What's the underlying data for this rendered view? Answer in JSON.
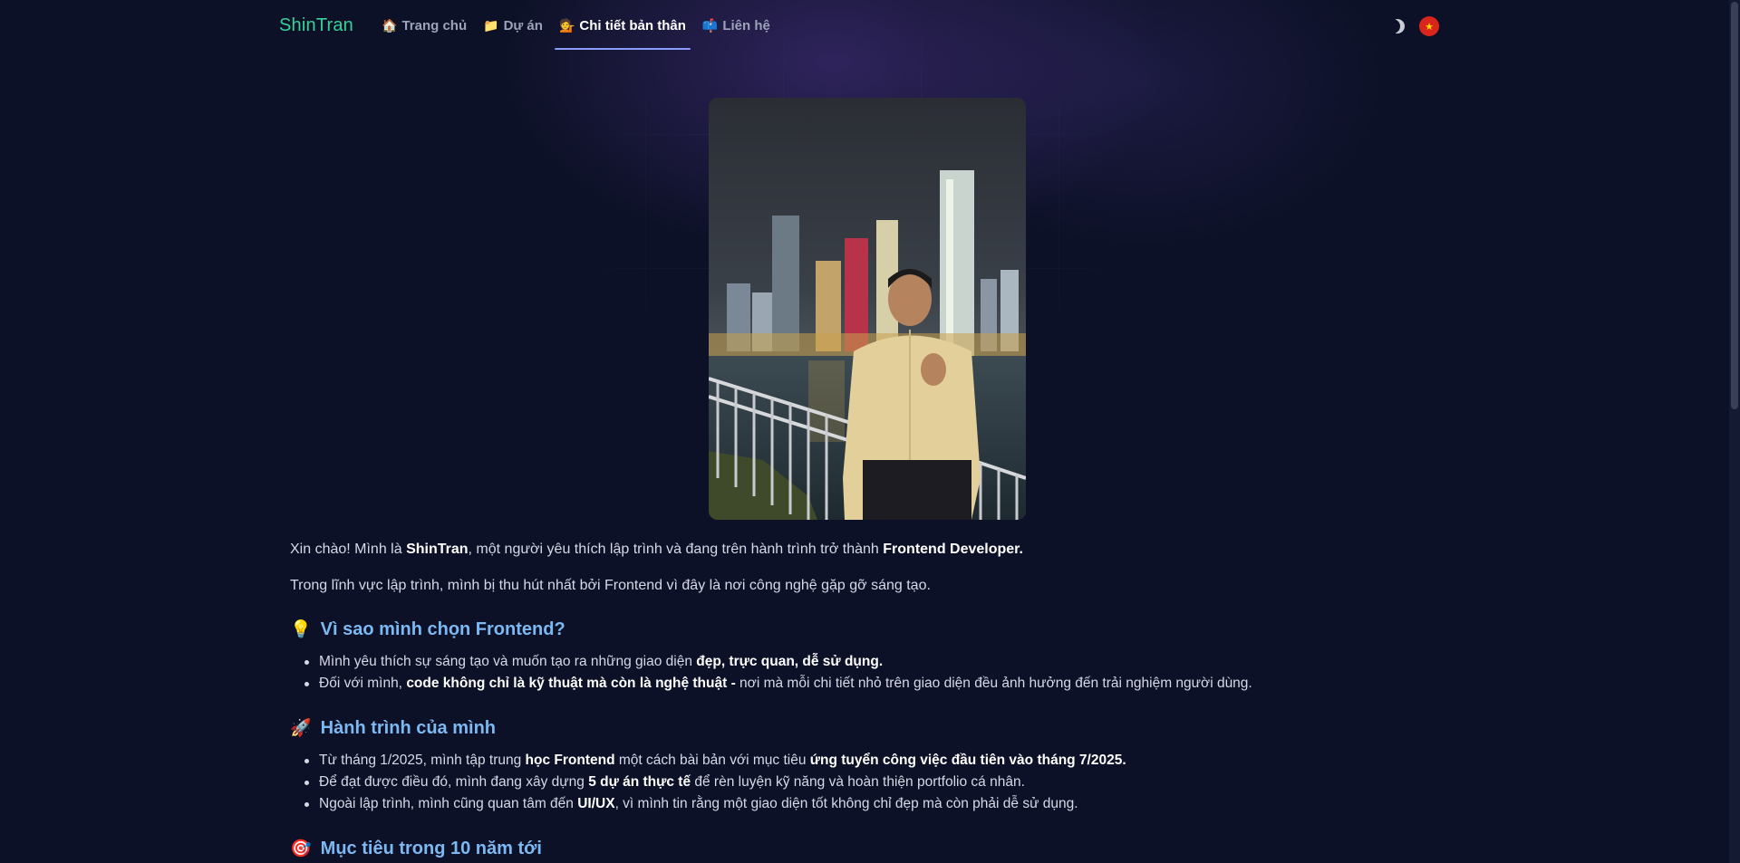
{
  "nav": {
    "logo": "ShinTran",
    "links": [
      {
        "emoji": "🏠",
        "label": "Trang chủ"
      },
      {
        "emoji": "📁",
        "label": "Dự án"
      },
      {
        "emoji": "💁",
        "label": "Chi tiết bản thân"
      },
      {
        "emoji": "📫",
        "label": "Liên hệ"
      }
    ],
    "active_index": 2,
    "theme_toggle_icon": "moon-icon",
    "language_flag_icon": "vietnam-flag-icon",
    "flag_star": "★"
  },
  "colors": {
    "background": "#0d1127",
    "logo": "#34d399",
    "heading": "#7cb9f3",
    "active_underline": "#8b9cff"
  },
  "intro": {
    "p1": {
      "t1": "Xin chào! Mình là ",
      "b1": "ShinTran",
      "t2": ", một người yêu thích lập trình và đang trên hành trình trở thành ",
      "b2": "Frontend Developer."
    },
    "p2": "Trong lĩnh vực lập trình, mình bị thu hút nhất bởi Frontend vì đây là nơi công nghệ gặp gỡ sáng tạo."
  },
  "sections": [
    {
      "emoji": "💡",
      "title": "Vì sao mình chọn Frontend?",
      "bullets": [
        {
          "t1": "Mình yêu thích sự sáng tạo và muốn tạo ra những giao diện ",
          "b1": "đẹp, trực quan, dễ sử dụng."
        },
        {
          "t1": "Đối với mình, ",
          "b1": "code không chỉ là kỹ thuật mà còn là nghệ thuật -",
          "t2": " nơi mà mỗi chi tiết nhỏ trên giao diện đều ảnh hưởng đến trải nghiệm người dùng."
        }
      ]
    },
    {
      "emoji": "🚀",
      "title": "Hành trình của mình",
      "bullets": [
        {
          "t1": "Từ tháng 1/2025, mình tập trung ",
          "b1": "học Frontend",
          "t2": " một cách bài bản với mục tiêu ",
          "b2": "ứng tuyển công việc đầu tiên vào tháng 7/2025."
        },
        {
          "t1": "Để đạt được điều đó, mình đang xây dựng ",
          "b1": "5 dự án thực tế",
          "t2": " để rèn luyện kỹ năng và hoàn thiện portfolio cá nhân."
        },
        {
          "t1": "Ngoài lập trình, mình cũng quan tâm đến ",
          "b1": "UI/UX",
          "t2": ", vì mình tin rằng một giao diện tốt không chỉ đẹp mà còn phải dễ sử dụng."
        }
      ]
    },
    {
      "emoji": "🎯",
      "title": "Mục tiêu trong 10 năm tới"
    }
  ]
}
